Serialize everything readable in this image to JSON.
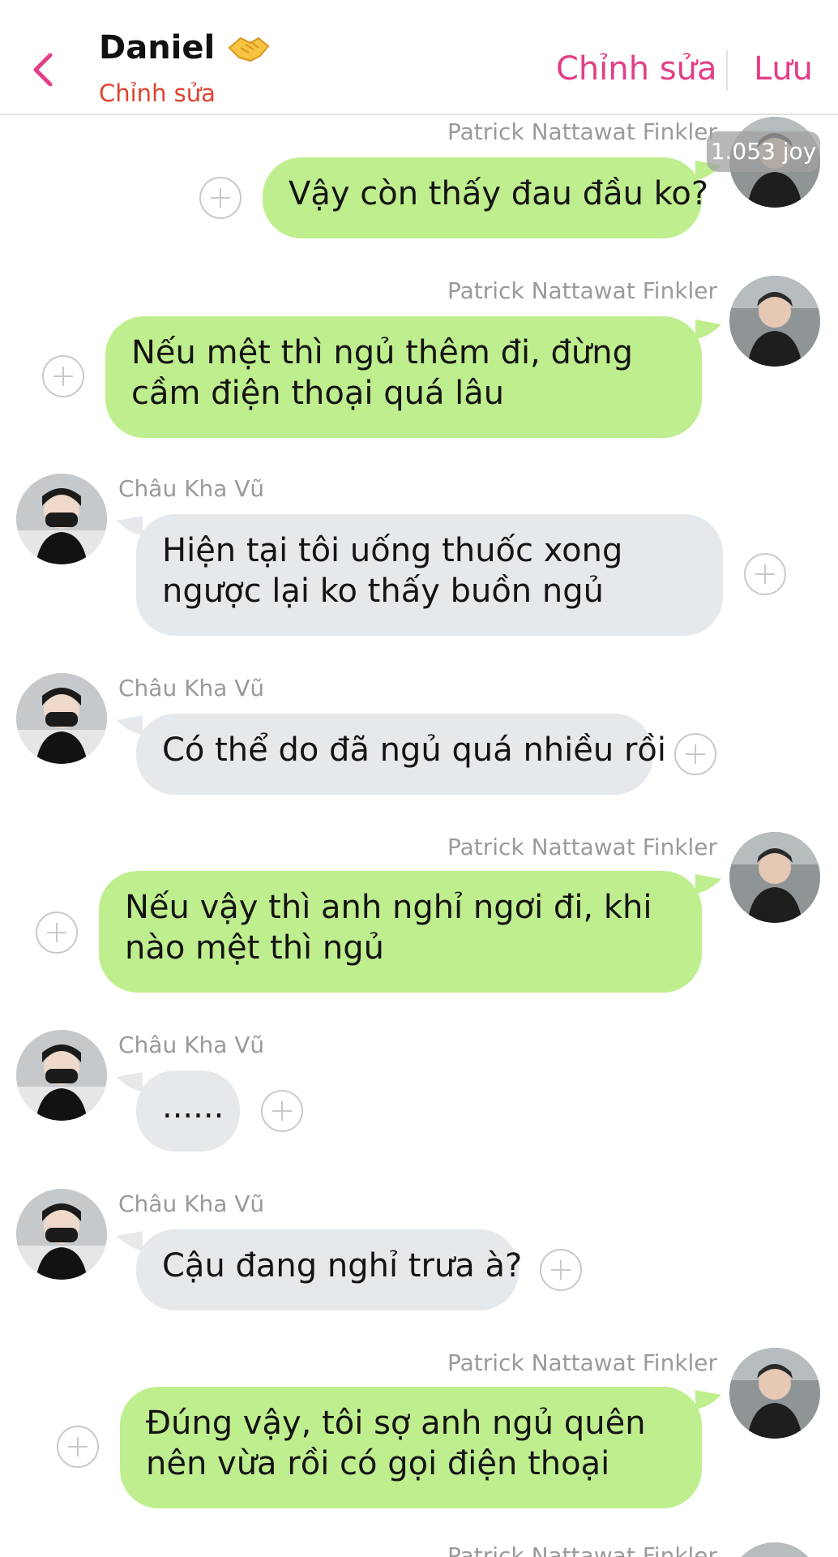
{
  "header": {
    "contact_name": "Daniel",
    "contact_emoji": "handshake-emoji",
    "subtitle": "Chỉnh sửa",
    "edit_label": "Chỉnh sửa",
    "save_label": "Lưu",
    "back_icon": "chevron-left-icon",
    "accent_color": "#e23f86",
    "subtitle_color": "#e0432f"
  },
  "overlay_badge": "1.053 joy",
  "colors": {
    "sent_bubble": "#bfee8e",
    "received_bubble": "#e6e9ec",
    "sender_name": "#9a9a9a"
  },
  "messages": [
    {
      "sender": "Patrick Nattawat Finkler",
      "text": "Vậy còn thấy đau đầu ko?",
      "side": "right"
    },
    {
      "sender": "Patrick Nattawat Finkler",
      "text": "Nếu mệt thì ngủ thêm đi, đừng cầm điện thoại quá lâu",
      "side": "right"
    },
    {
      "sender": "Châu Kha Vũ",
      "text": "Hiện tại tôi uống thuốc xong ngược lại ko thấy buồn ngủ",
      "side": "left"
    },
    {
      "sender": "Châu Kha Vũ",
      "text": "Có thể do đã ngủ quá nhiều rồi",
      "side": "left"
    },
    {
      "sender": "Patrick Nattawat Finkler",
      "text": "Nếu vậy thì anh nghỉ ngơi đi, khi nào mệt thì ngủ",
      "side": "right"
    },
    {
      "sender": "Châu Kha Vũ",
      "text": "......",
      "side": "left"
    },
    {
      "sender": "Châu Kha Vũ",
      "text": "Cậu đang nghỉ trưa à?",
      "side": "left"
    },
    {
      "sender": "Patrick Nattawat Finkler",
      "text": "Đúng vậy, tôi sợ anh ngủ quên nên vừa rồi có gọi điện thoại",
      "side": "right"
    },
    {
      "sender": "Patrick Nattawat Finkler",
      "text": "",
      "side": "right"
    }
  ]
}
